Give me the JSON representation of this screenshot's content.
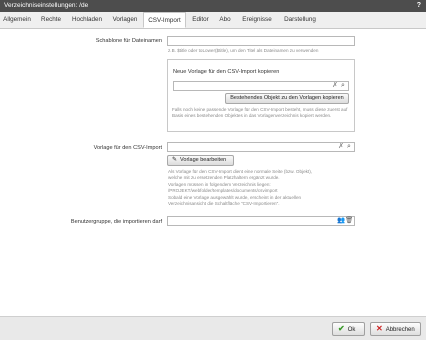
{
  "window": {
    "title": "Verzeichniseinstellungen: /de",
    "help_glyph": "?"
  },
  "tabs": [
    {
      "label": "Allgemein"
    },
    {
      "label": "Rechte"
    },
    {
      "label": "Hochladen"
    },
    {
      "label": "Vorlagen"
    },
    {
      "label": "CSV-Import"
    },
    {
      "label": "Editor"
    },
    {
      "label": "Abo"
    },
    {
      "label": "Ereignisse"
    },
    {
      "label": "Darstellung"
    }
  ],
  "form": {
    "schablone": {
      "label": "Schablone für Dateinamen",
      "value": "",
      "hint": "z.B. $title oder toLower($title), um den Titel als Dateinamen zu verwenden"
    },
    "neue_vorlage": {
      "title": "Neue Vorlage für den CSV-Import kopieren",
      "value": "",
      "copy_button": "Bestehendes Objekt zu den Vorlagen kopieren",
      "hint": "Falls noch keine passende Vorlage für den CSV-Import besteht, muss diese zuerst auf Basis eines bestehenden Objektes in das Vorlagenverzeichnis kopiert werden."
    },
    "vorlage_csv": {
      "label": "Vorlage für den CSV-Import",
      "value": "",
      "edit_button": "Vorlage bearbeiten",
      "hint_lines": [
        "Als Vorlage für den CSV-Import dient eine normale Seite (bzw. Objekt),",
        "welche mit zu ersetzenden Platzhaltern ergänzt wurde.",
        "Vorlagen müssen in folgendem Verzeichnis liegen:",
        "/PROJEKT/webfolder/templates/documents/csvimport",
        "Sobald eine Vorlage ausgewählt wurde, erscheint in der aktuellen",
        "Verzeichnisansicht die Schaltfläche \"CSV-Importieren\"."
      ]
    },
    "benutzergruppe": {
      "label": "Benutzergruppe, die importieren darf",
      "value": ""
    }
  },
  "footer": {
    "ok_label": "Ok",
    "cancel_label": "Abbrechen"
  },
  "colors": {
    "titlebar": "#4d4d4d",
    "ok_check": "#3a9a2a",
    "cancel_x": "#cc2222"
  }
}
